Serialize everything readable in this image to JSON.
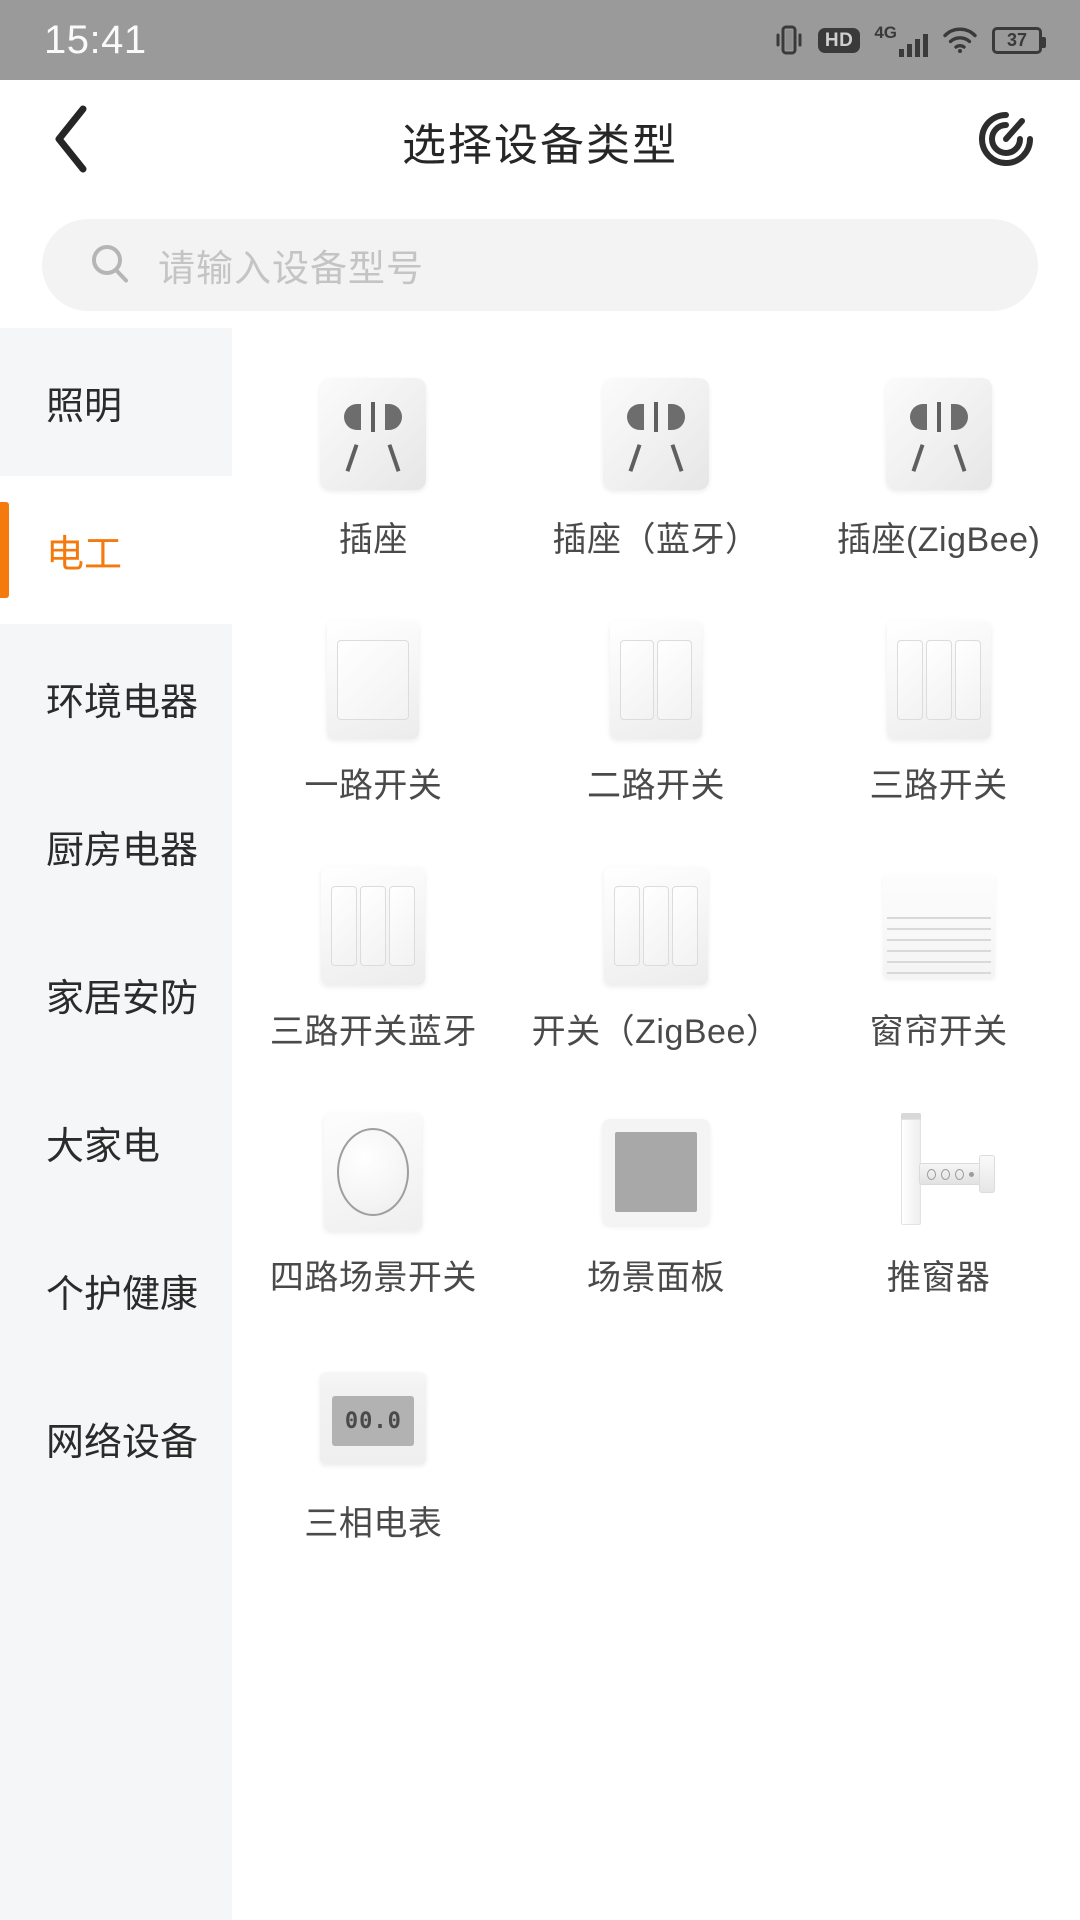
{
  "statusbar": {
    "time": "15:41",
    "network_label": "4G",
    "hd_label": "HD",
    "battery_level": "37",
    "icons": [
      "vibrate-icon",
      "hd-icon",
      "cellular-signal-icon",
      "wifi-icon",
      "battery-icon"
    ]
  },
  "header": {
    "title": "选择设备类型",
    "back_icon": "chevron-left-icon",
    "scan_icon": "scan-spiral-icon"
  },
  "search": {
    "placeholder": "请输入设备型号",
    "value": "",
    "icon": "search-icon"
  },
  "sidebar": {
    "active_index": 1,
    "items": [
      {
        "label": "照明"
      },
      {
        "label": "电工"
      },
      {
        "label": "环境电器"
      },
      {
        "label": "厨房电器"
      },
      {
        "label": "家居安防"
      },
      {
        "label": "大家电"
      },
      {
        "label": "个护健康"
      },
      {
        "label": "网络设备"
      }
    ]
  },
  "devices": [
    {
      "label": "插座",
      "icon": "socket-icon"
    },
    {
      "label": "插座（蓝牙）",
      "icon": "socket-bluetooth-icon"
    },
    {
      "label": "插座(ZigBee)",
      "icon": "socket-zigbee-icon"
    },
    {
      "label": "一路开关",
      "icon": "switch-1gang-icon"
    },
    {
      "label": "二路开关",
      "icon": "switch-2gang-icon"
    },
    {
      "label": "三路开关",
      "icon": "switch-3gang-icon"
    },
    {
      "label": "三路开关蓝牙",
      "icon": "switch-3gang-bluetooth-icon"
    },
    {
      "label": "开关（ZigBee）",
      "icon": "switch-zigbee-icon"
    },
    {
      "label": "窗帘开关",
      "icon": "curtain-switch-icon"
    },
    {
      "label": "四路场景开关",
      "icon": "scene-switch-4gang-icon"
    },
    {
      "label": "场景面板",
      "icon": "scene-panel-icon"
    },
    {
      "label": "推窗器",
      "icon": "window-opener-icon"
    },
    {
      "label": "三相电表",
      "icon": "three-phase-meter-icon"
    }
  ],
  "meter_display": "00.0",
  "colors": {
    "accent": "#f57a0e",
    "statusbar_bg": "#9a9a9a",
    "sidebar_bg": "#f5f6f7",
    "label_text": "#4a4a4a",
    "title_text": "#262626",
    "placeholder_text": "#c4c4c4"
  }
}
